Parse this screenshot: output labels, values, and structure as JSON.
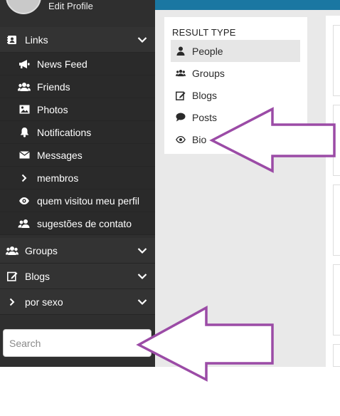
{
  "profile": {
    "name": "Edit Profile"
  },
  "sidebar": {
    "links": {
      "label": "Links",
      "icon": "address-book-icon",
      "items": [
        {
          "label": "News Feed",
          "icon": "bullhorn-icon"
        },
        {
          "label": "Friends",
          "icon": "users-icon"
        },
        {
          "label": "Photos",
          "icon": "image-icon"
        },
        {
          "label": "Notifications",
          "icon": "bell-icon"
        },
        {
          "label": "Messages",
          "icon": "envelope-icon"
        },
        {
          "label": "membros",
          "icon": "chevron-right-icon"
        },
        {
          "label": "quem visitou meu perfil",
          "icon": "eye-icon"
        },
        {
          "label": "sugestões de contato",
          "icon": "users-icon"
        }
      ]
    },
    "groups": {
      "label": "Groups",
      "icon": "users-icon"
    },
    "blogs": {
      "label": "Blogs",
      "icon": "edit-icon"
    },
    "por_sexo": {
      "label": "por sexo",
      "icon": "chevron-right-icon"
    }
  },
  "search": {
    "placeholder": "Search",
    "value": ""
  },
  "filter": {
    "title": "RESULT TYPE",
    "items": [
      {
        "label": "People",
        "icon": "user-icon",
        "active": true
      },
      {
        "label": "Groups",
        "icon": "users-icon",
        "active": false
      },
      {
        "label": "Blogs",
        "icon": "edit-icon",
        "active": false
      },
      {
        "label": "Posts",
        "icon": "comment-icon",
        "active": false
      },
      {
        "label": "Bio",
        "icon": "eye-icon",
        "active": false
      }
    ]
  },
  "colors": {
    "sidebar_bg": "#2f2f2f",
    "topbar": "#1a77a2",
    "arrow": "#9b4ba6",
    "main_bg": "#e9e9e9"
  }
}
